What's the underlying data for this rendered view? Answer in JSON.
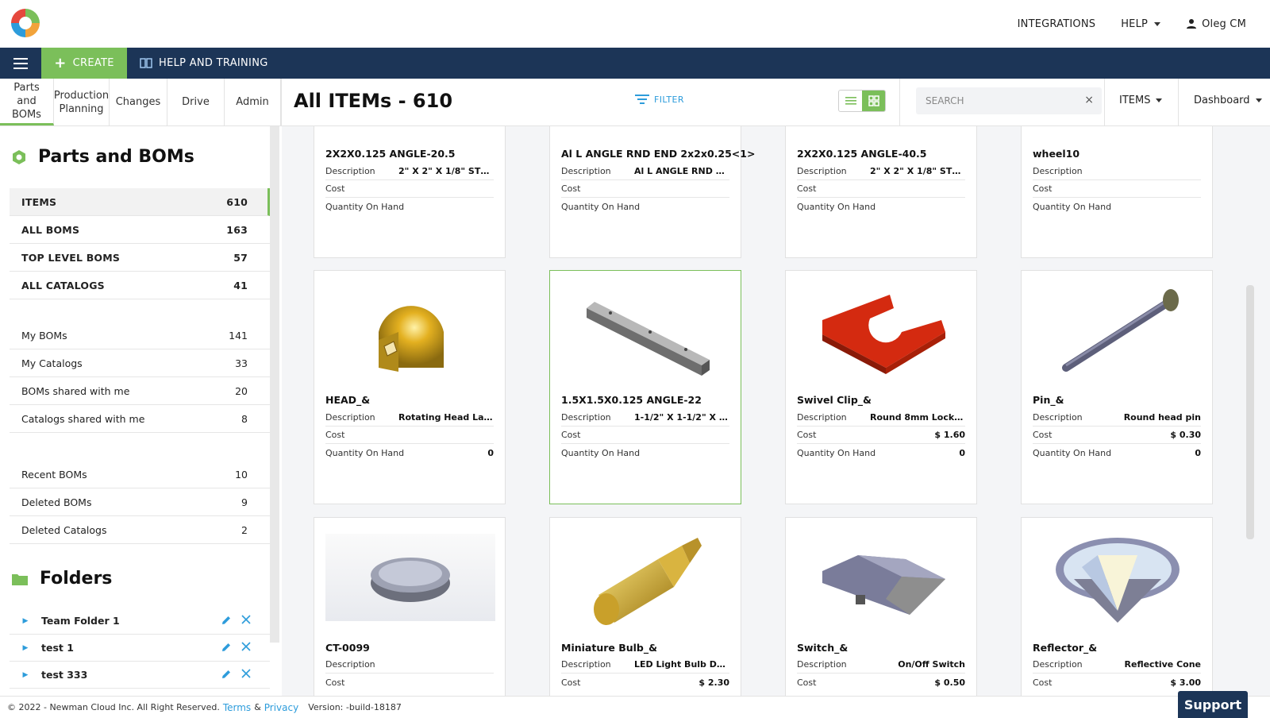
{
  "header": {
    "integrations": "INTEGRATIONS",
    "help": "HELP",
    "user": "Oleg CM"
  },
  "navbar": {
    "create": "CREATE",
    "help_training": "HELP AND TRAINING"
  },
  "module_tabs": [
    {
      "label": "Parts and BOMs"
    },
    {
      "label": "Production Planning"
    },
    {
      "label": "Changes"
    },
    {
      "label": "Drive"
    },
    {
      "label": "Admin"
    }
  ],
  "toolbar": {
    "title": "All ITEMs - 610",
    "filter": "FILTER",
    "search_placeholder": "SEARCH",
    "clear": "×",
    "items_dropdown": "ITEMS",
    "dashboard_dropdown": "Dashboard"
  },
  "sidebar": {
    "heading": "Parts and BOMs",
    "primary": [
      {
        "label": "ITEMS",
        "count": "610"
      },
      {
        "label": "ALL BOMS",
        "count": "163"
      },
      {
        "label": "TOP LEVEL BOMS",
        "count": "57"
      },
      {
        "label": "ALL CATALOGS",
        "count": "41"
      }
    ],
    "mine": [
      {
        "label": "My BOMs",
        "count": "141"
      },
      {
        "label": "My Catalogs",
        "count": "33"
      },
      {
        "label": "BOMs shared with me",
        "count": "20"
      },
      {
        "label": "Catalogs shared with me",
        "count": "8"
      }
    ],
    "recent": [
      {
        "label": "Recent BOMs",
        "count": "10"
      },
      {
        "label": "Deleted BOMs",
        "count": "9"
      },
      {
        "label": "Deleted Catalogs",
        "count": "2"
      }
    ],
    "folders_heading": "Folders",
    "folders": [
      {
        "label": "Team Folder 1"
      },
      {
        "label": "test 1"
      },
      {
        "label": "test 333"
      }
    ]
  },
  "field_labels": {
    "description": "Description",
    "cost": "Cost",
    "qty": "Quantity On Hand"
  },
  "cards": [
    {
      "name": "2X2X0.125 ANGLE-20.5",
      "description": "2\" X 2\" X 1/8\" STE...",
      "cost": "",
      "qty": ""
    },
    {
      "name": "Al L ANGLE RND END 2x2x0.25<1>",
      "description": "Al L ANGLE RND E...",
      "cost": "",
      "qty": ""
    },
    {
      "name": "2X2X0.125 ANGLE-40.5",
      "description": "2\" X 2\" X 1/8\" STE...",
      "cost": "",
      "qty": ""
    },
    {
      "name": "wheel10",
      "description": "",
      "cost": "",
      "qty": ""
    },
    {
      "name": "HEAD_&",
      "description": "Rotating Head Lamp",
      "cost": "",
      "qty": "0",
      "icon": "lamp-head-icon"
    },
    {
      "name": "1.5X1.5X0.125 ANGLE-22",
      "description": "1-1/2\" X 1-1/2\" X 1...",
      "cost": "",
      "qty": "",
      "icon": "angle-bracket-icon"
    },
    {
      "name": "Swivel Clip_&",
      "description": "Round 8mm Locki...",
      "cost": "$ 1.60",
      "qty": "0",
      "icon": "swivel-clip-icon"
    },
    {
      "name": "Pin_&",
      "description": "Round head pin",
      "cost": "$ 0.30",
      "qty": "0",
      "icon": "pin-icon"
    },
    {
      "name": "CT-0099",
      "description": "",
      "cost": "",
      "qty": "",
      "icon": "cap-icon"
    },
    {
      "name": "Miniature Bulb_&",
      "description": "LED Light Bulb DC ...",
      "cost": "$ 2.30",
      "qty": "",
      "icon": "bulb-icon"
    },
    {
      "name": "Switch_&",
      "description": "On/Off Switch",
      "cost": "$ 0.50",
      "qty": "",
      "icon": "switch-icon"
    },
    {
      "name": "Reflector_&",
      "description": "Reflective Cone",
      "cost": "$ 3.00",
      "qty": "",
      "icon": "reflector-icon"
    }
  ],
  "footer": {
    "copyright": "© 2022 - Newman Cloud Inc. All Right Reserved.",
    "terms": "Terms",
    "amp": "&",
    "privacy": "Privacy",
    "version": "Version: -build-18187"
  },
  "support": "Support",
  "colors": {
    "navy": "#1c3557",
    "green": "#7bbf5a",
    "link": "#2d9cdb"
  }
}
